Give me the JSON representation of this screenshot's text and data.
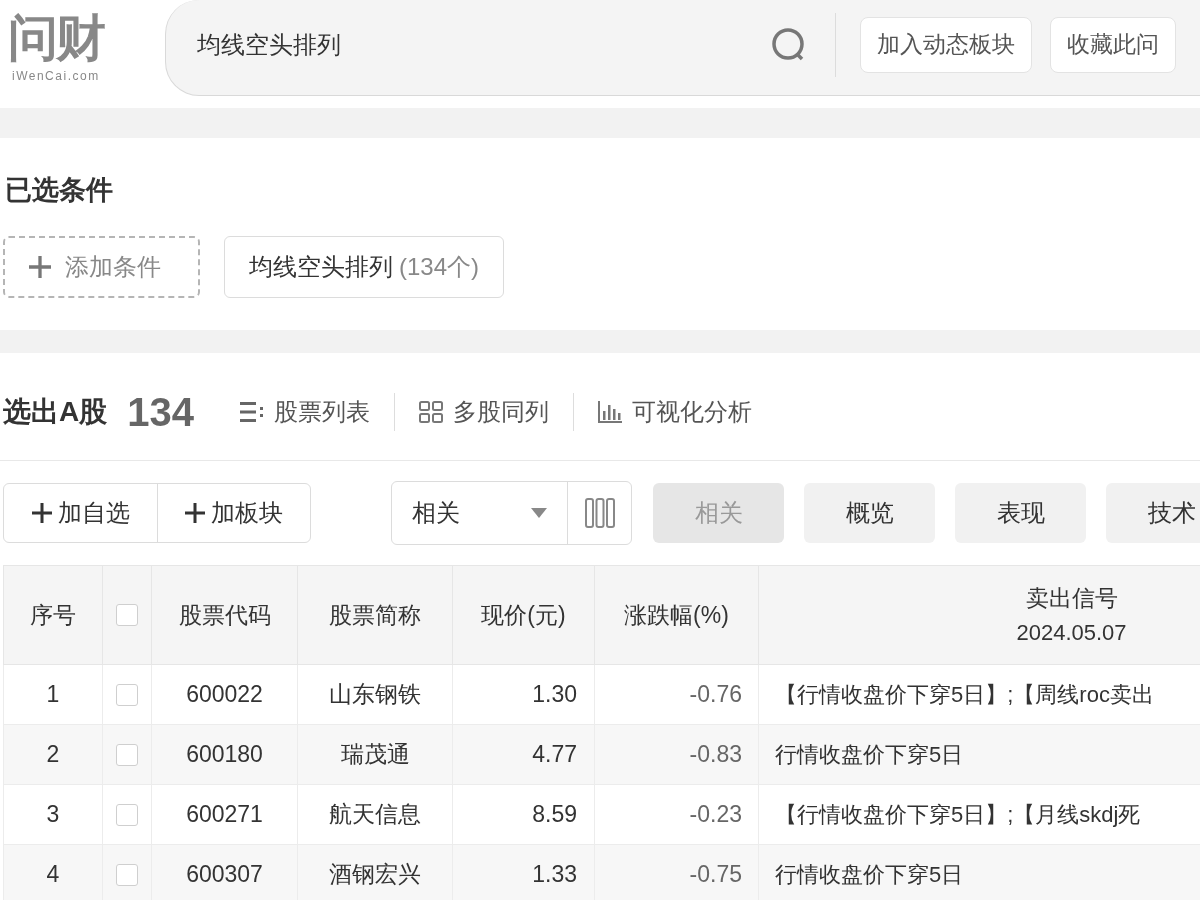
{
  "header": {
    "logo": {
      "text": "问财",
      "domain": "iWenCai.com"
    },
    "search": {
      "value": "均线空头排列"
    },
    "buttons": [
      "加入动态板块",
      "收藏此问"
    ]
  },
  "conditions": {
    "title": "已选条件",
    "add_label": "添加条件",
    "chips": [
      {
        "label": "均线空头排列",
        "count": "(134个)"
      }
    ]
  },
  "results": {
    "title": "选出A股",
    "count": "134",
    "views": [
      {
        "kind": "list",
        "label": "股票列表"
      },
      {
        "kind": "grid",
        "label": "多股同列"
      },
      {
        "kind": "chart",
        "label": "可视化分析"
      }
    ]
  },
  "toolbar": {
    "actions": [
      "加自选",
      "加板块"
    ],
    "select": {
      "value": "相关"
    },
    "tabs": [
      {
        "label": "相关",
        "selected": true
      },
      {
        "label": "概览",
        "selected": false
      },
      {
        "label": "表现",
        "selected": false
      },
      {
        "label": "技术",
        "selected": false
      }
    ]
  },
  "table": {
    "columns": [
      {
        "kind": "text",
        "label": "序号"
      },
      {
        "kind": "checkbox",
        "checked": false
      },
      {
        "kind": "text",
        "label": "股票代码"
      },
      {
        "kind": "text",
        "label": "股票简称"
      },
      {
        "kind": "text",
        "label": "现价(元)"
      },
      {
        "kind": "text",
        "label": "涨跌幅(%)"
      },
      {
        "kind": "text",
        "label": "卖出信号",
        "sublabel": "2024.05.07"
      }
    ],
    "rows": [
      {
        "index": "1",
        "checked": false,
        "code": "600022",
        "name": "山东钢铁",
        "price": "1.30",
        "change": "-0.76",
        "signal": "【行情收盘价下穿5日】;【周线roc卖出"
      },
      {
        "index": "2",
        "checked": false,
        "code": "600180",
        "name": "瑞茂通",
        "price": "4.77",
        "change": "-0.83",
        "signal": "行情收盘价下穿5日"
      },
      {
        "index": "3",
        "checked": false,
        "code": "600271",
        "name": "航天信息",
        "price": "8.59",
        "change": "-0.23",
        "signal": "【行情收盘价下穿5日】;【月线skdj死"
      },
      {
        "index": "4",
        "checked": false,
        "code": "600307",
        "name": "酒钢宏兴",
        "price": "1.33",
        "change": "-0.75",
        "signal": "行情收盘价下穿5日"
      }
    ]
  }
}
